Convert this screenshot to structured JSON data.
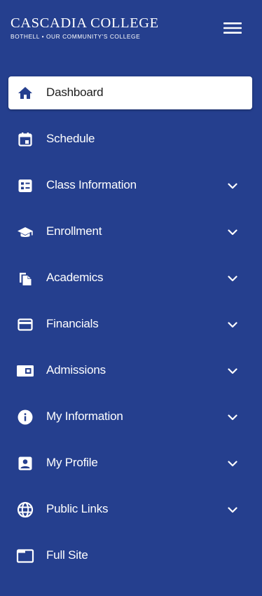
{
  "brand": {
    "name": "CASCADIA COLLEGE",
    "tagline": "BOTHELL • OUR COMMUNITY'S COLLEGE"
  },
  "colors": {
    "background": "#253f8e",
    "active_background": "#ffffff",
    "active_icon": "#253f8e",
    "text": "#ffffff",
    "active_text": "#1d1d1d"
  },
  "header": {
    "menu_icon": "hamburger-icon"
  },
  "nav": {
    "items": [
      {
        "label": "Dashboard",
        "icon": "home-icon",
        "active": true,
        "expandable": false
      },
      {
        "label": "Schedule",
        "icon": "calendar-icon",
        "active": false,
        "expandable": false
      },
      {
        "label": "Class Information",
        "icon": "class-info-icon",
        "active": false,
        "expandable": true
      },
      {
        "label": "Enrollment",
        "icon": "graduation-cap-icon",
        "active": false,
        "expandable": true
      },
      {
        "label": "Academics",
        "icon": "documents-icon",
        "active": false,
        "expandable": true
      },
      {
        "label": "Financials",
        "icon": "credit-card-icon",
        "active": false,
        "expandable": true
      },
      {
        "label": "Admissions",
        "icon": "admissions-icon",
        "active": false,
        "expandable": true
      },
      {
        "label": "My Information",
        "icon": "info-icon",
        "active": false,
        "expandable": true
      },
      {
        "label": "My Profile",
        "icon": "profile-icon",
        "active": false,
        "expandable": true
      },
      {
        "label": "Public Links",
        "icon": "globe-icon",
        "active": false,
        "expandable": true
      },
      {
        "label": "Full Site",
        "icon": "full-site-icon",
        "active": false,
        "expandable": false
      }
    ]
  }
}
